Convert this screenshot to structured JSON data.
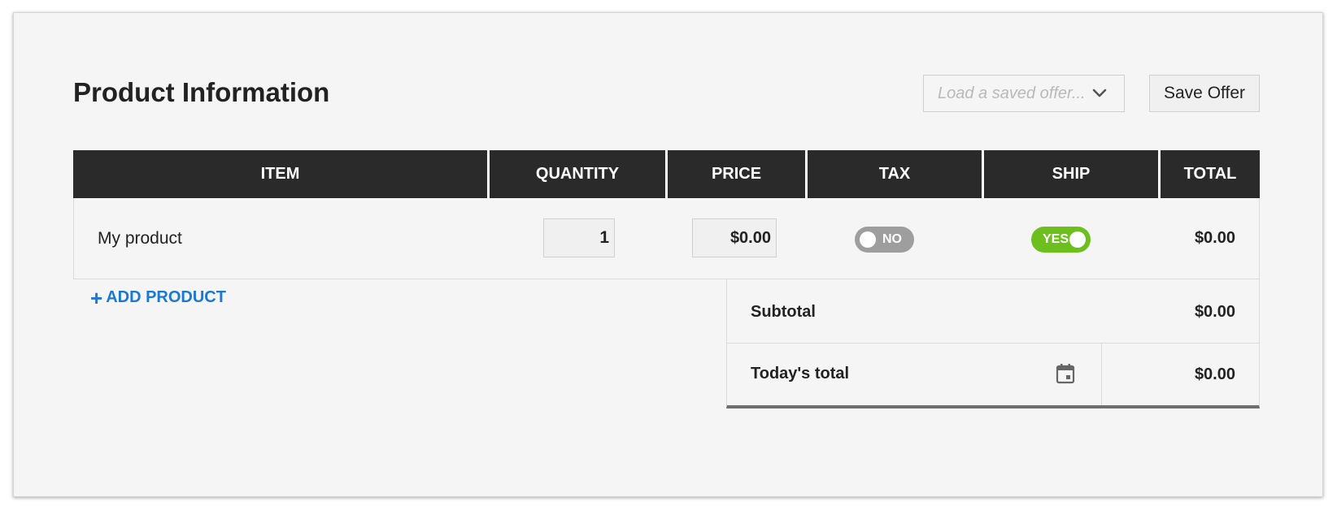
{
  "header": {
    "title": "Product Information",
    "load_offer_placeholder": "Load a saved offer...",
    "save_offer_label": "Save Offer"
  },
  "table": {
    "columns": [
      "ITEM",
      "QUANTITY",
      "PRICE",
      "TAX",
      "SHIP",
      "TOTAL"
    ],
    "rows": [
      {
        "item": "My product",
        "quantity": "1",
        "price": "$0.00",
        "tax": "NO",
        "ship": "YES",
        "total": "$0.00"
      }
    ]
  },
  "add_product_label": "ADD PRODUCT",
  "summary": {
    "subtotal_label": "Subtotal",
    "subtotal_value": "$0.00",
    "today_label": "Today's total",
    "today_value": "$0.00"
  },
  "icons": {
    "dropdown": "chevron-down-icon",
    "add": "plus-icon",
    "date": "calendar-icon"
  },
  "colors": {
    "header_bg": "#2a2a2a",
    "accent_link": "#1b78d4",
    "toggle_on": "#6cbf1c",
    "toggle_off": "#9e9e9e"
  }
}
